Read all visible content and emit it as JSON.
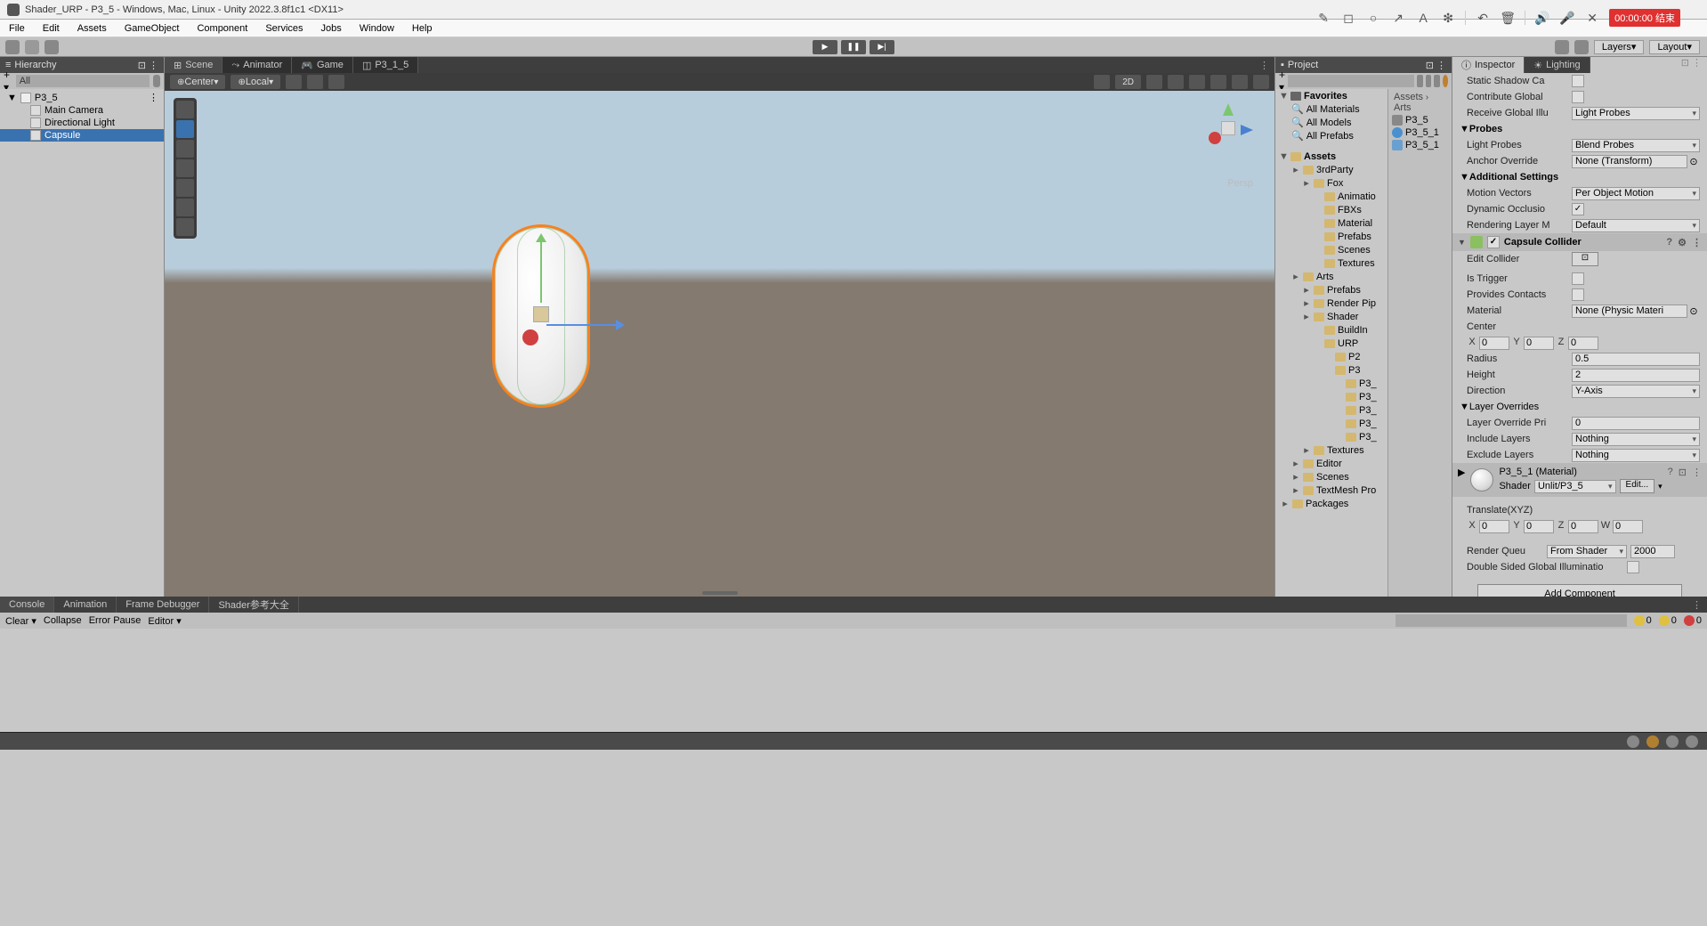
{
  "window": {
    "title": "Shader_URP - P3_5 - Windows, Mac, Linux - Unity 2022.3.8f1c1 <DX11>"
  },
  "menu": [
    "File",
    "Edit",
    "Assets",
    "GameObject",
    "Component",
    "Services",
    "Jobs",
    "Window",
    "Help"
  ],
  "toolbar": {
    "layers": "Layers",
    "layout": "Layout"
  },
  "hierarchy": {
    "title": "Hierarchy",
    "search": "All",
    "scene": "P3_5",
    "items": [
      "Main Camera",
      "Directional Light",
      "Capsule"
    ],
    "selected": "Capsule"
  },
  "center_tabs": [
    {
      "label": "Scene",
      "icon": "scene-icon"
    },
    {
      "label": "Animator",
      "icon": "animator-icon"
    },
    {
      "label": "Game",
      "icon": "game-icon"
    },
    {
      "label": "P3_1_5",
      "icon": "shader-icon"
    }
  ],
  "scene_tb": {
    "pivot": "Center",
    "space": "Local",
    "two_d": "2D"
  },
  "persp": "Persp",
  "project": {
    "title": "Project",
    "crumb_root": "Assets",
    "crumb_sub": "Arts",
    "favorites": "Favorites",
    "fav_items": [
      "All Materials",
      "All Models",
      "All Prefabs"
    ],
    "assets": "Assets",
    "tree": [
      {
        "l": 1,
        "n": "3rdParty"
      },
      {
        "l": 2,
        "n": "Fox"
      },
      {
        "l": 3,
        "n": "Animatio"
      },
      {
        "l": 3,
        "n": "FBXs"
      },
      {
        "l": 3,
        "n": "Material"
      },
      {
        "l": 3,
        "n": "Prefabs"
      },
      {
        "l": 3,
        "n": "Scenes"
      },
      {
        "l": 3,
        "n": "Textures"
      },
      {
        "l": 1,
        "n": "Arts"
      },
      {
        "l": 2,
        "n": "Prefabs"
      },
      {
        "l": 2,
        "n": "Render Pip"
      },
      {
        "l": 2,
        "n": "Shader"
      },
      {
        "l": 3,
        "n": "BuildIn"
      },
      {
        "l": 3,
        "n": "URP"
      },
      {
        "l": 4,
        "n": "P2"
      },
      {
        "l": 4,
        "n": "P3"
      },
      {
        "l": 5,
        "n": "P3_"
      },
      {
        "l": 5,
        "n": "P3_"
      },
      {
        "l": 5,
        "n": "P3_"
      },
      {
        "l": 5,
        "n": "P3_"
      },
      {
        "l": 5,
        "n": "P3_"
      },
      {
        "l": 2,
        "n": "Textures"
      },
      {
        "l": 1,
        "n": "Editor"
      },
      {
        "l": 1,
        "n": "Scenes"
      },
      {
        "l": 1,
        "n": "TextMesh Pro"
      },
      {
        "l": 0,
        "n": "Packages"
      }
    ],
    "right": [
      "P3_5",
      "P3_5_1",
      "P3_5_1"
    ]
  },
  "inspector": {
    "tab1": "Inspector",
    "tab2": "Lighting",
    "static_shadow": "Static Shadow Ca",
    "contrib": "Contribute Global",
    "recv_gi": "Receive Global Illu",
    "recv_gi_v": "Light Probes",
    "probes": "Probes",
    "light_probes": "Light Probes",
    "light_probes_v": "Blend Probes",
    "anchor": "Anchor Override",
    "anchor_v": "None (Transform)",
    "addl": "Additional Settings",
    "motion": "Motion Vectors",
    "motion_v": "Per Object Motion",
    "dyn_occ": "Dynamic Occlusio",
    "render_layer": "Rendering Layer M",
    "render_layer_v": "Default",
    "collider": "Capsule Collider",
    "edit_col": "Edit Collider",
    "is_trigger": "Is Trigger",
    "prov_contacts": "Provides Contacts",
    "material": "Material",
    "material_v": "None (Physic Materi",
    "center": "Center",
    "cx": "0",
    "cy": "0",
    "cz": "0",
    "radius": "Radius",
    "radius_v": "0.5",
    "height": "Height",
    "height_v": "2",
    "direction": "Direction",
    "direction_v": "Y-Axis",
    "layer_ov": "Layer Overrides",
    "layer_ov_pri": "Layer Override Pri",
    "layer_ov_pri_v": "0",
    "inc_layers": "Include Layers",
    "inc_layers_v": "Nothing",
    "exc_layers": "Exclude Layers",
    "exc_layers_v": "Nothing",
    "mat_name": "P3_5_1 (Material)",
    "shader": "Shader",
    "shader_v": "Unlit/P3_5",
    "edit": "Edit...",
    "translate": "Translate(XYZ)",
    "tx": "0",
    "ty": "0",
    "tz": "0",
    "tw": "0",
    "render_q": "Render Queu",
    "render_q_v": "From Shader",
    "render_q_n": "2000",
    "dsgi": "Double Sided Global Illuminatio",
    "add_comp": "Add Component"
  },
  "console": {
    "tabs": [
      "Console",
      "Animation",
      "Frame Debugger",
      "Shader参考大全"
    ],
    "clear": "Clear",
    "collapse": "Collapse",
    "error_pause": "Error Pause",
    "editor": "Editor",
    "warn": "0",
    "info": "0",
    "err": "0"
  },
  "rec": {
    "time": "00:00:00",
    "label": "结束"
  }
}
